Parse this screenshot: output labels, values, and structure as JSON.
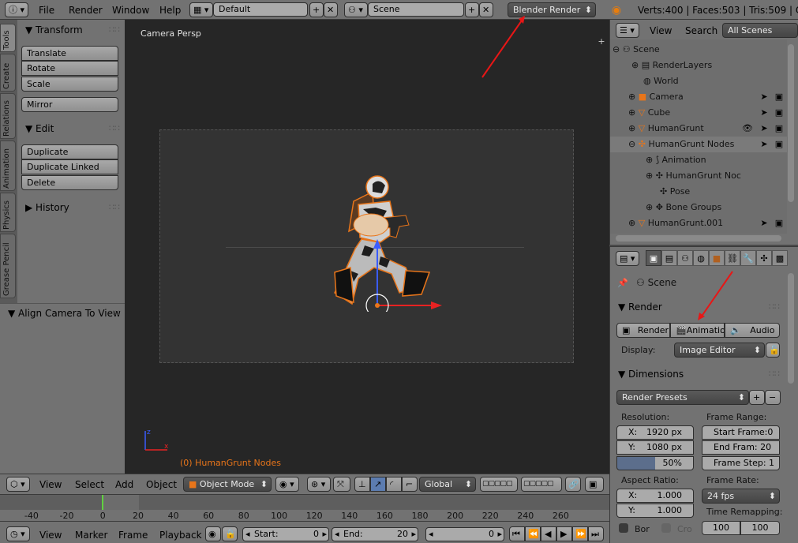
{
  "top": {
    "menus": [
      "File",
      "Render",
      "Window",
      "Help"
    ],
    "layout": "Default",
    "scene": "Scene",
    "engine": "Blender Render",
    "stats": "Verts:400 | Faces:503 | Tris:509 | O"
  },
  "toolshelf": {
    "tabs": [
      "Tools",
      "Create",
      "Relations",
      "Animation",
      "Physics",
      "Grease Pencil"
    ],
    "transform": {
      "title": "Transform",
      "buttons": [
        "Translate",
        "Rotate",
        "Scale"
      ],
      "mirror": "Mirror"
    },
    "edit": {
      "title": "Edit",
      "buttons": [
        "Duplicate",
        "Duplicate Linked",
        "Delete"
      ]
    },
    "history": "History",
    "operator": "Align Camera To View"
  },
  "viewport": {
    "view_name": "Camera Persp",
    "object_label": "(0) HumanGrunt Nodes"
  },
  "outliner": {
    "header": [
      "View",
      "Search",
      "All Scenes"
    ],
    "items": [
      "Scene",
      "RenderLayers",
      "World",
      "Camera",
      "Cube",
      "HumanGrunt",
      "HumanGrunt Nodes",
      "Animation",
      "HumanGrunt Noc",
      "Pose",
      "Bone Groups",
      "HumanGrunt.001"
    ]
  },
  "properties": {
    "breadcrumb": "Scene",
    "render_panel": "Render",
    "render_buttons": [
      "Render",
      "Animation",
      "Audio"
    ],
    "display_label": "Display:",
    "display_value": "Image Editor",
    "dimensions": "Dimensions",
    "presets": "Render Presets",
    "resolution_label": "Resolution:",
    "res_x": "1920 px",
    "res_y": "1080 px",
    "res_pct": "50%",
    "frame_range_label": "Frame Range:",
    "start_frame": "Start Frame:0",
    "end_frame": "End Fram:  20",
    "frame_step": "Frame Step: 1",
    "aspect_label": "Aspect Ratio:",
    "aspect_x": "1.000",
    "aspect_y": "1.000",
    "frame_rate_label": "Frame Rate:",
    "fps": "24 fps",
    "time_remap_label": "Time Remapping:",
    "remap_old": "100",
    "remap_new": "100",
    "border": "Bor",
    "crop": "Cro",
    "x_label": "X:",
    "y_label": "Y:"
  },
  "view3d_header": {
    "menus": [
      "View",
      "Select",
      "Add",
      "Object"
    ],
    "mode": "Object Mode",
    "orientation": "Global"
  },
  "timeline": {
    "ticks": [
      "-40",
      "-20",
      "0",
      "20",
      "40",
      "60",
      "80",
      "100",
      "120",
      "140",
      "160",
      "180",
      "200",
      "220",
      "240",
      "260"
    ],
    "menus": [
      "View",
      "Marker",
      "Frame",
      "Playback"
    ],
    "start_label": "Start:",
    "start_value": "0",
    "end_label": "End:",
    "end_value": "20",
    "current": "0"
  }
}
